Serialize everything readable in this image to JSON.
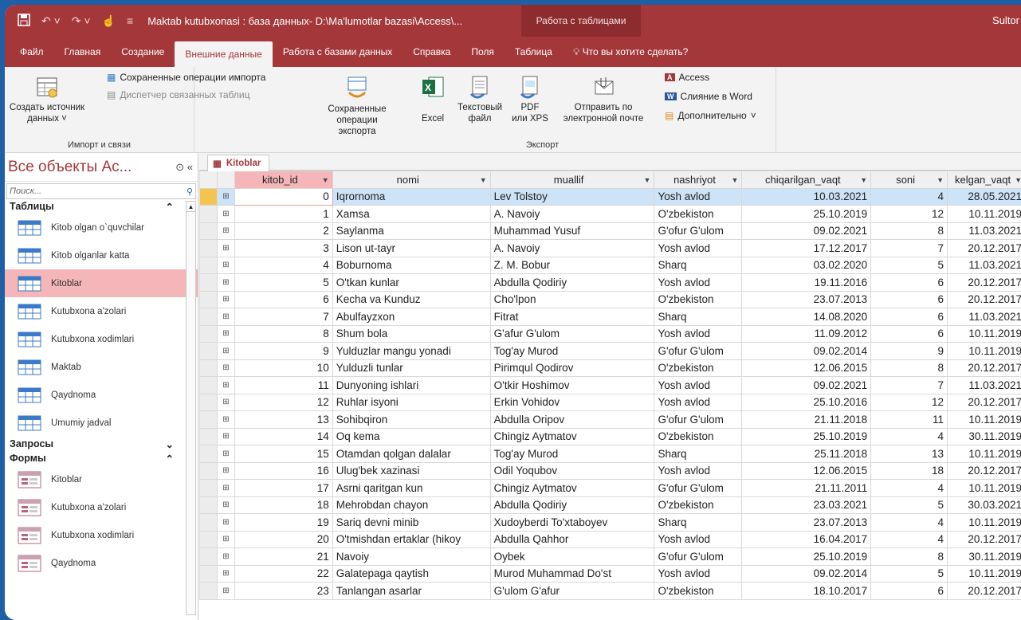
{
  "title_bar": {
    "qa_icons": [
      "save-icon",
      "undo-icon",
      "redo-icon",
      "touch-mode-icon",
      "customize-icon"
    ],
    "title": "Maktab kutubxonasi : база данных- D:\\Ma'lumotlar bazasi\\Access\\...",
    "context_tab": "Работа с таблицами",
    "user": "Sultor"
  },
  "tabs": [
    "Файл",
    "Главная",
    "Создание",
    "Внешние данные",
    "Работа с базами данных",
    "Справка",
    "Поля",
    "Таблица"
  ],
  "active_tab": "Внешние данные",
  "tell_me": "Что вы хотите сделать?",
  "ribbon": {
    "import": {
      "label": "Импорт и связи",
      "new_source": "Создать источник",
      "new_source_2": "данных",
      "saved_imports": "Сохраненные операции импорта",
      "linked_mgr": "Диспетчер связанных таблиц"
    },
    "export": {
      "label": "Экспорт",
      "saved_exports": "Сохраненные",
      "saved_exports_2": "операции экспорта",
      "excel": "Excel",
      "text": "Текстовый",
      "text_2": "файл",
      "pdf": "PDF",
      "pdf_2": "или XPS",
      "email": "Отправить по",
      "email_2": "электронной почте",
      "access": "Access",
      "word": "Слияние в Word",
      "more": "Дополнительно"
    }
  },
  "nav": {
    "title": "Все объекты Ac...",
    "search_placeholder": "Поиск...",
    "tables_header": "Таблицы",
    "tables": [
      "Kitob olgan o`quvchilar",
      "Kitob olganlar katta",
      "Kitoblar",
      "Kutubxona a'zolari",
      "Kutubxona xodimlari",
      "Maktab",
      "Qaydnoma",
      "Umumiy jadval"
    ],
    "selected_table": "Kitoblar",
    "queries_header": "Запросы",
    "forms_header": "Формы",
    "forms": [
      "Kitoblar",
      "Kutubxona a'zolari",
      "Kutubxona xodimlari",
      "Qaydnoma"
    ]
  },
  "doc_tab": "Kitoblar",
  "table": {
    "columns": [
      "kitob_id",
      "nomi",
      "muallif",
      "nashriyot",
      "chiqarilgan_vaqt",
      "soni",
      "kelgan_vaqt"
    ],
    "rows": [
      [
        "0",
        "Iqrornoma",
        "Lev Tolstoy",
        "Yosh avlod",
        "10.03.2021",
        "4",
        "28.05.2021"
      ],
      [
        "1",
        "Xamsa",
        "A. Navoiy",
        "O'zbekiston",
        "25.10.2019",
        "12",
        "10.11.2019"
      ],
      [
        "2",
        "Saylanma",
        "Muhammad Yusuf",
        "G'ofur G'ulom",
        "09.02.2021",
        "8",
        "11.03.2021"
      ],
      [
        "3",
        "Lison ut-tayr",
        "A. Navoiy",
        "Yosh avlod",
        "17.12.2017",
        "7",
        "20.12.2017"
      ],
      [
        "4",
        "Boburnoma",
        "Z. M. Bobur",
        "Sharq",
        "03.02.2020",
        "5",
        "11.03.2021"
      ],
      [
        "5",
        "O'tkan kunlar",
        "Abdulla Qodiriy",
        "Yosh avlod",
        "19.11.2016",
        "6",
        "20.12.2017"
      ],
      [
        "6",
        "Kecha va Kunduz",
        "Cho'lpon",
        "O'zbekiston",
        "23.07.2013",
        "6",
        "20.12.2017"
      ],
      [
        "7",
        "Abulfayzxon",
        "Fitrat",
        "Sharq",
        "14.08.2020",
        "6",
        "11.03.2021"
      ],
      [
        "8",
        "Shum bola",
        "G'afur G'ulom",
        "Yosh avlod",
        "11.09.2012",
        "6",
        "10.11.2019"
      ],
      [
        "9",
        "Yulduzlar mangu yonadi",
        "Tog'ay Murod",
        "G'ofur G'ulom",
        "09.02.2014",
        "9",
        "10.11.2019"
      ],
      [
        "10",
        "Yulduzli tunlar",
        "Pirimqul Qodirov",
        "O'zbekiston",
        "12.06.2015",
        "8",
        "20.12.2017"
      ],
      [
        "11",
        "Dunyoning ishlari",
        "O'tkir Hoshimov",
        "Yosh avlod",
        "09.02.2021",
        "7",
        "11.03.2021"
      ],
      [
        "12",
        "Ruhlar isyoni",
        "Erkin Vohidov",
        "Yosh avlod",
        "25.10.2016",
        "12",
        "20.12.2017"
      ],
      [
        "13",
        "Sohibqiron",
        "Abdulla Oripov",
        "G'ofur G'ulom",
        "21.11.2018",
        "11",
        "10.11.2019"
      ],
      [
        "14",
        "Oq kema",
        "Chingiz Aytmatov",
        "O'zbekiston",
        "25.10.2019",
        "4",
        "30.11.2019"
      ],
      [
        "15",
        "Otamdan qolgan dalalar",
        "Tog'ay Murod",
        "Sharq",
        "25.11.2018",
        "13",
        "10.11.2019"
      ],
      [
        "16",
        "Ulug'bek xazinasi",
        "Odil Yoqubov",
        "Yosh avlod",
        "12.06.2015",
        "18",
        "20.12.2017"
      ],
      [
        "17",
        "Asrni qaritgan kun",
        "Chingiz Aytmatov",
        "G'ofur G'ulom",
        "21.11.2011",
        "4",
        "10.11.2019"
      ],
      [
        "18",
        "Mehrobdan chayon",
        "Abdulla Qodiriy",
        "O'zbekiston",
        "23.03.2021",
        "5",
        "30.03.2021"
      ],
      [
        "19",
        "Sariq devni minib",
        "Xudoyberdi To'xtaboyev",
        "Sharq",
        "23.07.2013",
        "4",
        "10.11.2019"
      ],
      [
        "20",
        "O'tmishdan ertaklar (hikoy",
        "Abdulla Qahhor",
        "Yosh avlod",
        "16.04.2017",
        "4",
        "20.12.2017"
      ],
      [
        "21",
        "Navoiy",
        "Oybek",
        "G'ofur G'ulom",
        "25.10.2019",
        "8",
        "30.11.2019"
      ],
      [
        "22",
        "Galatepaga qaytish",
        "Murod Muhammad Do'st",
        "Yosh avlod",
        "09.02.2014",
        "5",
        "10.11.2019"
      ],
      [
        "23",
        "Tanlangan asarlar",
        "G'ulom G'afur",
        "O'zbekiston",
        "18.10.2017",
        "6",
        "20.12.2017"
      ]
    ]
  },
  "colors": {
    "accent": "#a4373a",
    "selection": "#cde3f7"
  }
}
